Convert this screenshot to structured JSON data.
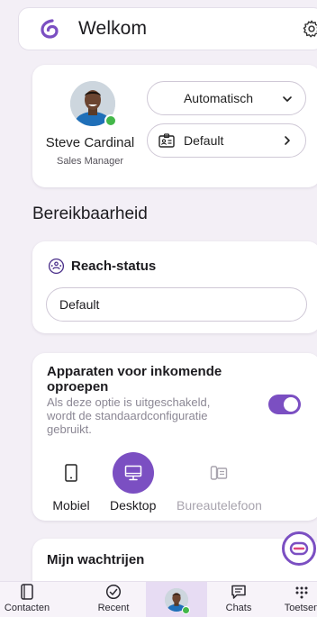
{
  "header": {
    "title": "Welkom",
    "logo_icon": "brand-logo-icon",
    "settings_icon": "gear-icon"
  },
  "profile": {
    "name": "Steve Cardinal",
    "role": "Sales Manager",
    "presence": "online",
    "mode_select": "Automatisch",
    "status_label": "Default"
  },
  "section_title": "Bereikbaarheid",
  "reach": {
    "title": "Reach-status",
    "value": "Default"
  },
  "devices": {
    "title": "Apparaten voor inkomende oproepen",
    "subtitle": "Als deze optie is uitgeschakeld, wordt de standaardconfiguratie gebruikt.",
    "toggle_on": true,
    "options": [
      {
        "label": "Mobiel",
        "selected": false,
        "enabled": true
      },
      {
        "label": "Desktop",
        "selected": true,
        "enabled": true
      },
      {
        "label": "Bureautelefoon",
        "selected": false,
        "enabled": false
      }
    ]
  },
  "queues": {
    "title": "Mijn wachtrijen"
  },
  "nav": {
    "items": [
      {
        "label": "Contacten",
        "icon": "contacts-icon"
      },
      {
        "label": "Recent",
        "icon": "recent-icon"
      },
      {
        "label": "",
        "icon": "avatar"
      },
      {
        "label": "Chats",
        "icon": "chat-icon"
      },
      {
        "label": "Toetsen",
        "icon": "keypad-icon"
      }
    ]
  },
  "colors": {
    "accent": "#7b4fc2",
    "background": "#f3eff6",
    "presence": "#43b749"
  }
}
